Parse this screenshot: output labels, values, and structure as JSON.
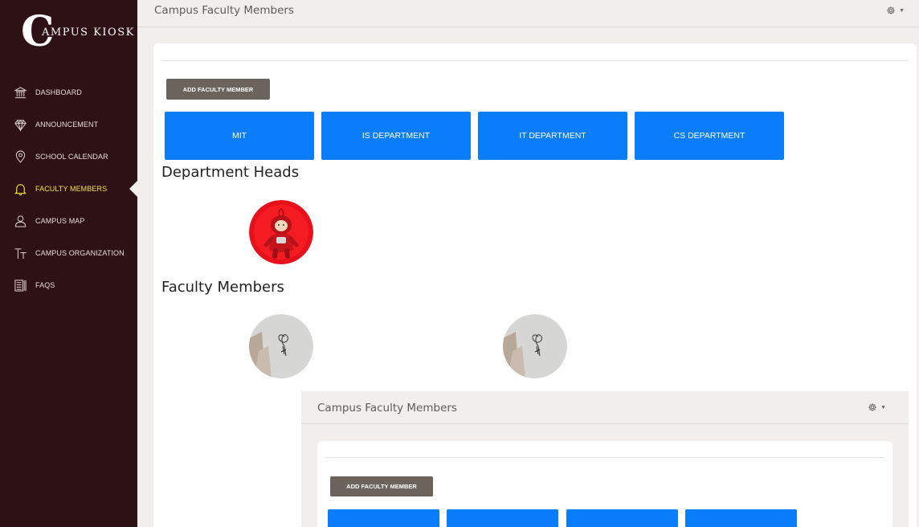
{
  "brand": {
    "initial": "C",
    "rest": "AMPUS KIOSK"
  },
  "sidebar": {
    "items": [
      {
        "label": "DASHBOARD",
        "icon": "bank-icon"
      },
      {
        "label": "ANNOUNCEMENT",
        "icon": "diamond-icon"
      },
      {
        "label": "SCHOOL CALENDAR",
        "icon": "map-pin-icon"
      },
      {
        "label": "FACULTY MEMBERS",
        "icon": "bell-icon",
        "active": true
      },
      {
        "label": "CAMPUS MAP",
        "icon": "user-icon"
      },
      {
        "label": "CAMPUS ORGANIZATION",
        "icon": "text-size-icon"
      },
      {
        "label": "FAQS",
        "icon": "list-icon"
      }
    ]
  },
  "header": {
    "title": "Campus Faculty Members",
    "settings_icon": "gear-icon"
  },
  "main": {
    "add_button": "ADD FACULTY MEMBER",
    "departments": [
      "MIT",
      "IS DEPARTMENT",
      "IT DEPARTMENT",
      "CS DEPARTMENT"
    ],
    "heads_heading": "Department Heads",
    "members_heading": "Faculty Members"
  },
  "nested": {
    "title": "Campus Faculty Members",
    "add_button": "ADD FACULTY MEMBER"
  },
  "colors": {
    "sidebar_bg": "#2e1114",
    "active_nav": "#f5e642",
    "department_button": "#0a7dfb",
    "add_button": "#6b635c",
    "page_bg": "#f0efec"
  }
}
